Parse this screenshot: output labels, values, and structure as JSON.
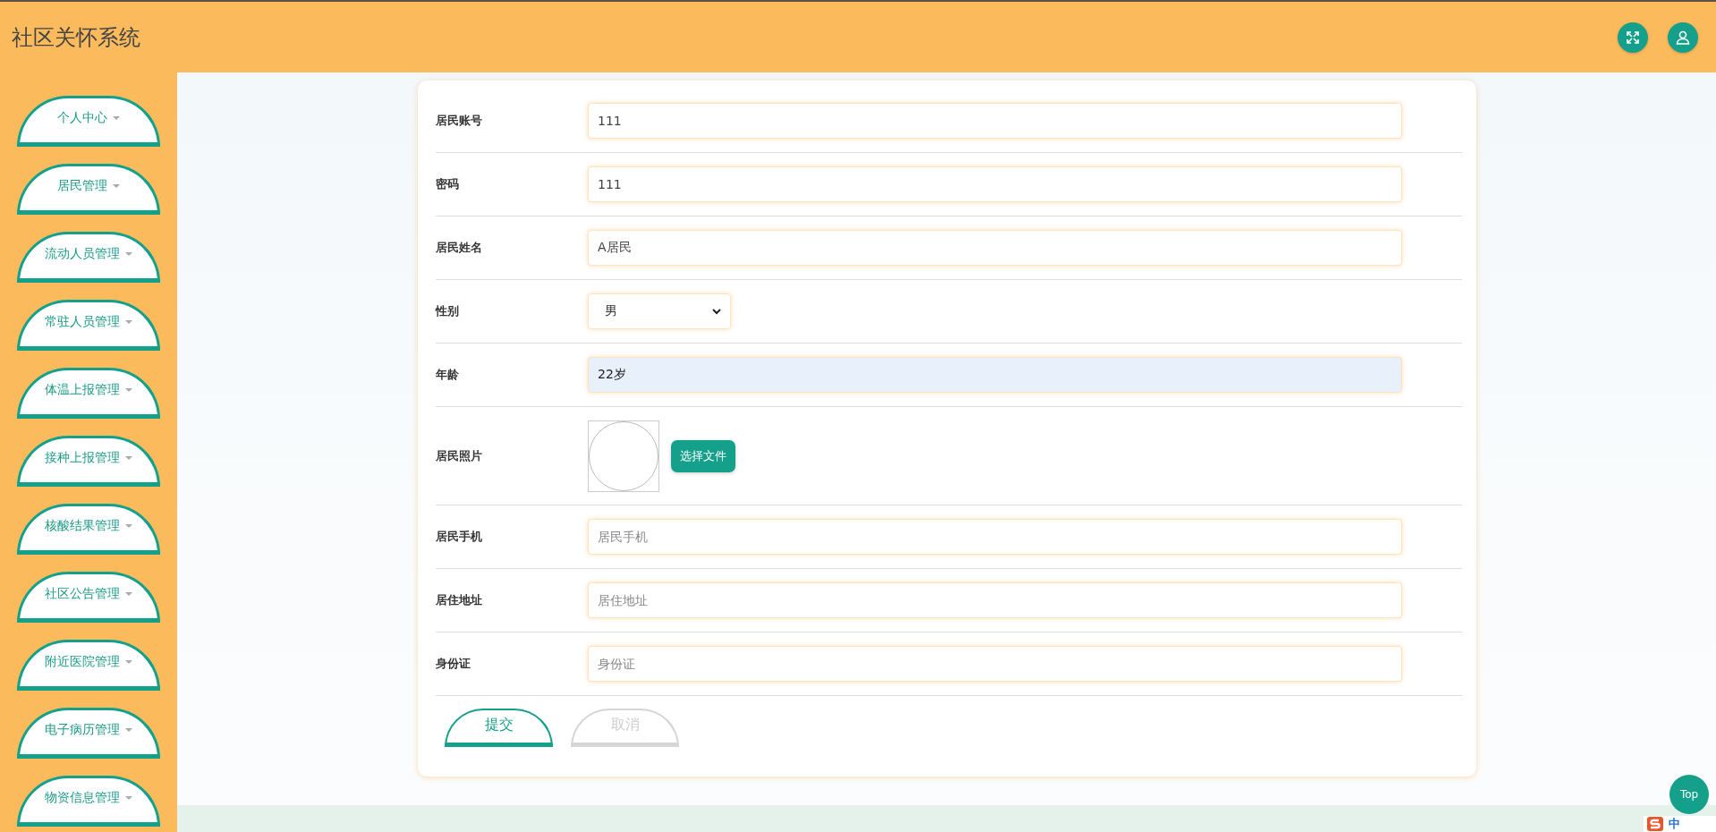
{
  "header": {
    "title": "社区关怀系统"
  },
  "sidebar": {
    "items": [
      {
        "label": "个人中心"
      },
      {
        "label": "居民管理"
      },
      {
        "label": "流动人员管理"
      },
      {
        "label": "常驻人员管理"
      },
      {
        "label": "体温上报管理"
      },
      {
        "label": "接种上报管理"
      },
      {
        "label": "核酸结果管理"
      },
      {
        "label": "社区公告管理"
      },
      {
        "label": "附近医院管理"
      },
      {
        "label": "电子病历管理"
      },
      {
        "label": "物资信息管理"
      }
    ]
  },
  "form": {
    "fields": [
      {
        "kind": "text",
        "label": "居民账号",
        "value": "111",
        "focused": false
      },
      {
        "kind": "text",
        "label": "密码",
        "value": "111",
        "focused": false
      },
      {
        "kind": "text",
        "label": "居民姓名",
        "value": "A居民",
        "focused": false
      },
      {
        "kind": "select",
        "label": "性别",
        "value": "男"
      },
      {
        "kind": "text",
        "label": "年龄",
        "value": "22岁",
        "focused": true
      },
      {
        "kind": "image",
        "label": "居民照片",
        "button": "选择文件"
      },
      {
        "kind": "text",
        "label": "居民手机",
        "placeholder": "居民手机",
        "focused": false
      },
      {
        "kind": "text",
        "label": "居住地址",
        "placeholder": "居住地址",
        "focused": false
      },
      {
        "kind": "text",
        "label": "身份证",
        "placeholder": "身份证",
        "focused": false
      }
    ],
    "buttons": [
      {
        "kind": "primary",
        "label": "提交"
      },
      {
        "kind": "secondary",
        "label": "取消"
      }
    ]
  },
  "top_button": "Top",
  "ime_toolbar": {
    "label": "中"
  }
}
